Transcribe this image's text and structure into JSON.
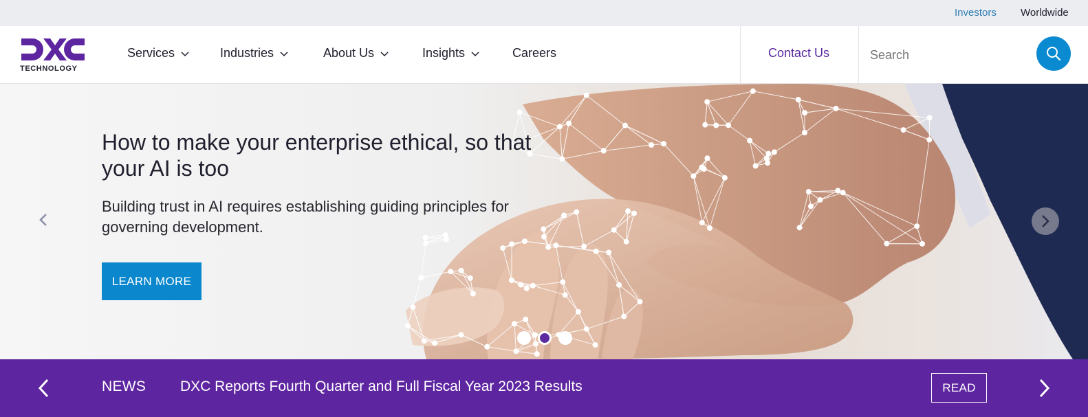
{
  "utility": {
    "investors_label": "Investors",
    "worldwide_label": "Worldwide"
  },
  "header": {
    "logo": {
      "wordmark": "DXC",
      "subtext": "TECHNOLOGY",
      "icon": "dxc-logo"
    },
    "nav": [
      {
        "label": "Services",
        "has_dropdown": true
      },
      {
        "label": "Industries",
        "has_dropdown": true
      },
      {
        "label": "About Us",
        "has_dropdown": true
      },
      {
        "label": "Insights",
        "has_dropdown": true
      },
      {
        "label": "Careers",
        "has_dropdown": false
      }
    ],
    "contact_label": "Contact Us",
    "search": {
      "placeholder": "Search",
      "value": "",
      "icon": "search-icon"
    }
  },
  "hero": {
    "headline": "How to make your enterprise ethical, so that your AI is too",
    "subheadline": "Building trust in AI requires establishing guiding principles for governing development.",
    "cta_label": "LEARN MORE",
    "prev_icon": "chevron-left-icon",
    "next_icon": "chevron-right-icon",
    "slides_total": 3,
    "active_slide": 2
  },
  "news": {
    "label": "NEWS",
    "headline": "DXC Reports Fourth Quarter and Full Fiscal Year 2023 Results",
    "read_label": "READ",
    "prev_icon": "chevron-left-icon",
    "next_icon": "chevron-right-icon"
  },
  "colors": {
    "brand_purple": "#5e25a0",
    "accent_blue": "#0a87cd",
    "link_blue": "#2f7eb3",
    "utility_bg": "#ecedf1"
  }
}
